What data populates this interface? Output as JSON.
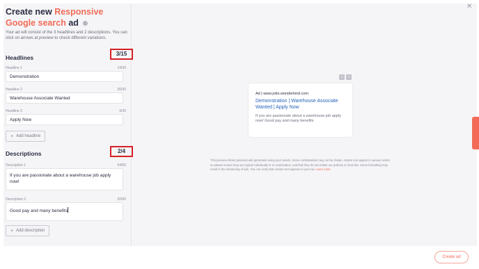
{
  "header": {
    "title_prefix": "Create new",
    "title_accent_1": "Responsive",
    "title_accent_2": "Google search",
    "title_suffix": "ad",
    "subtitle": "Your ad will consist of the 3 headlines and 2 descriptions. You can click on arrows at preview to check different variations."
  },
  "headlines": {
    "title": "Headlines",
    "counter": "3/15",
    "items": [
      {
        "label": "Headline 1",
        "count": "14/30",
        "value": "Demonstration"
      },
      {
        "label": "Headline 2",
        "count": "26/30",
        "value": "Warehouse Associate Wanted"
      },
      {
        "label": "Headline 3",
        "count": "9/30",
        "value": "Apply Now"
      }
    ],
    "add_label": "Add headline"
  },
  "descriptions": {
    "title": "Descriptions",
    "counter": "2/4",
    "items": [
      {
        "label": "Description 1",
        "count": "54/90",
        "value": "If you are passionate about a warehouse job apply now!"
      },
      {
        "label": "Description 2",
        "count": "26/90",
        "value": "Good pay and many benefits"
      }
    ],
    "add_label": "Add description"
  },
  "preview": {
    "ad_url": "Ad | www.jobs.wonderkind.com",
    "ad_headline": "Demonstration | Warehouse Associate Wanted | Apply Now",
    "ad_description": "If you are passionate about a warehouse job apply now! Good pay and many benefits",
    "disclaimer": "This preview shows potential ads generated using your assets. Some combinations may not be shown. Assets can appear in various orders so please ensure they are logical individually or in combination, and that they do not violate our policies or local law. Some formatting may result in the shortening of ads. You can verify that certain text appears in your ad.",
    "learn_more": "Learn more"
  },
  "footer": {
    "create_label": "Create ad"
  },
  "colors": {
    "accent": "#f26b57",
    "link": "#2563b8",
    "highlight_box": "#d61f26"
  },
  "icons": [
    "info-icon",
    "plus-icon",
    "arrow-left-icon",
    "arrow-right-icon",
    "close-icon"
  ]
}
